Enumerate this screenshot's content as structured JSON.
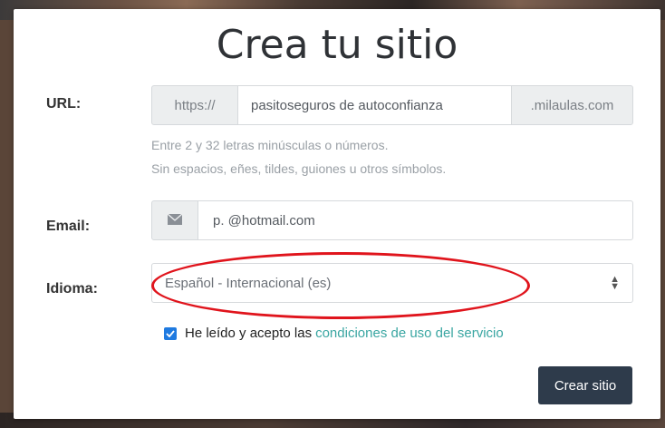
{
  "dialog": {
    "title": "Crea tu sitio"
  },
  "url_field": {
    "label": "URL:",
    "prefix": "https://",
    "value": "pasitoseguros de autoconfianza",
    "suffix": ".milaulas.com",
    "help_line_1": "Entre 2 y 32 letras minúsculas o números.",
    "help_line_2": "Sin espacios, eñes, tildes, guiones u otros símbolos."
  },
  "email_field": {
    "label": "Email:",
    "icon": "envelope-icon",
    "value": "p.         @hotmail.com"
  },
  "language_field": {
    "label": "Idioma:",
    "selected": "Español - Internacional (es)",
    "icon": "select-updown-icon"
  },
  "terms": {
    "checked": true,
    "text": "He leído y acepto las",
    "link_text": "condiciones de uso del servicio"
  },
  "submit": {
    "label": "Crear sitio"
  },
  "colors": {
    "accent_link": "#3aa6a2",
    "button_bg": "#2e3b4b",
    "checkbox": "#1f7ae0",
    "annotation": "#e0141c"
  }
}
